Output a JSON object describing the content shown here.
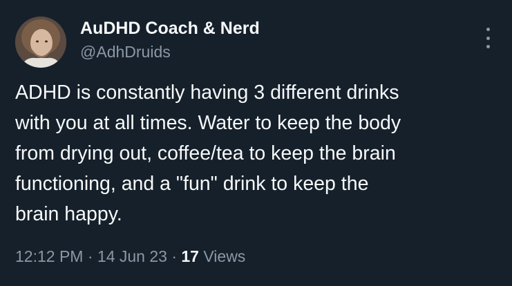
{
  "author": {
    "display_name": "AuDHD Coach & Nerd",
    "handle": "@AdhDruids",
    "avatar_icon": "user-avatar-photo"
  },
  "tweet": {
    "lines": [
      "ADHD is constantly having 3 different drinks",
      "with you at all times. Water to keep the body",
      "from drying out, coffee/tea to keep the brain",
      "functioning, and a \"fun\" drink to keep the",
      "brain happy."
    ]
  },
  "meta": {
    "time": "12:12 PM",
    "separator": "·",
    "date": "14 Jun 23",
    "views_count": "17",
    "views_label": "Views"
  },
  "colors": {
    "background": "#15202b",
    "primary_text": "#f7f9f9",
    "secondary_text": "#8b98a5"
  },
  "icons": {
    "more": "more-options-icon"
  }
}
